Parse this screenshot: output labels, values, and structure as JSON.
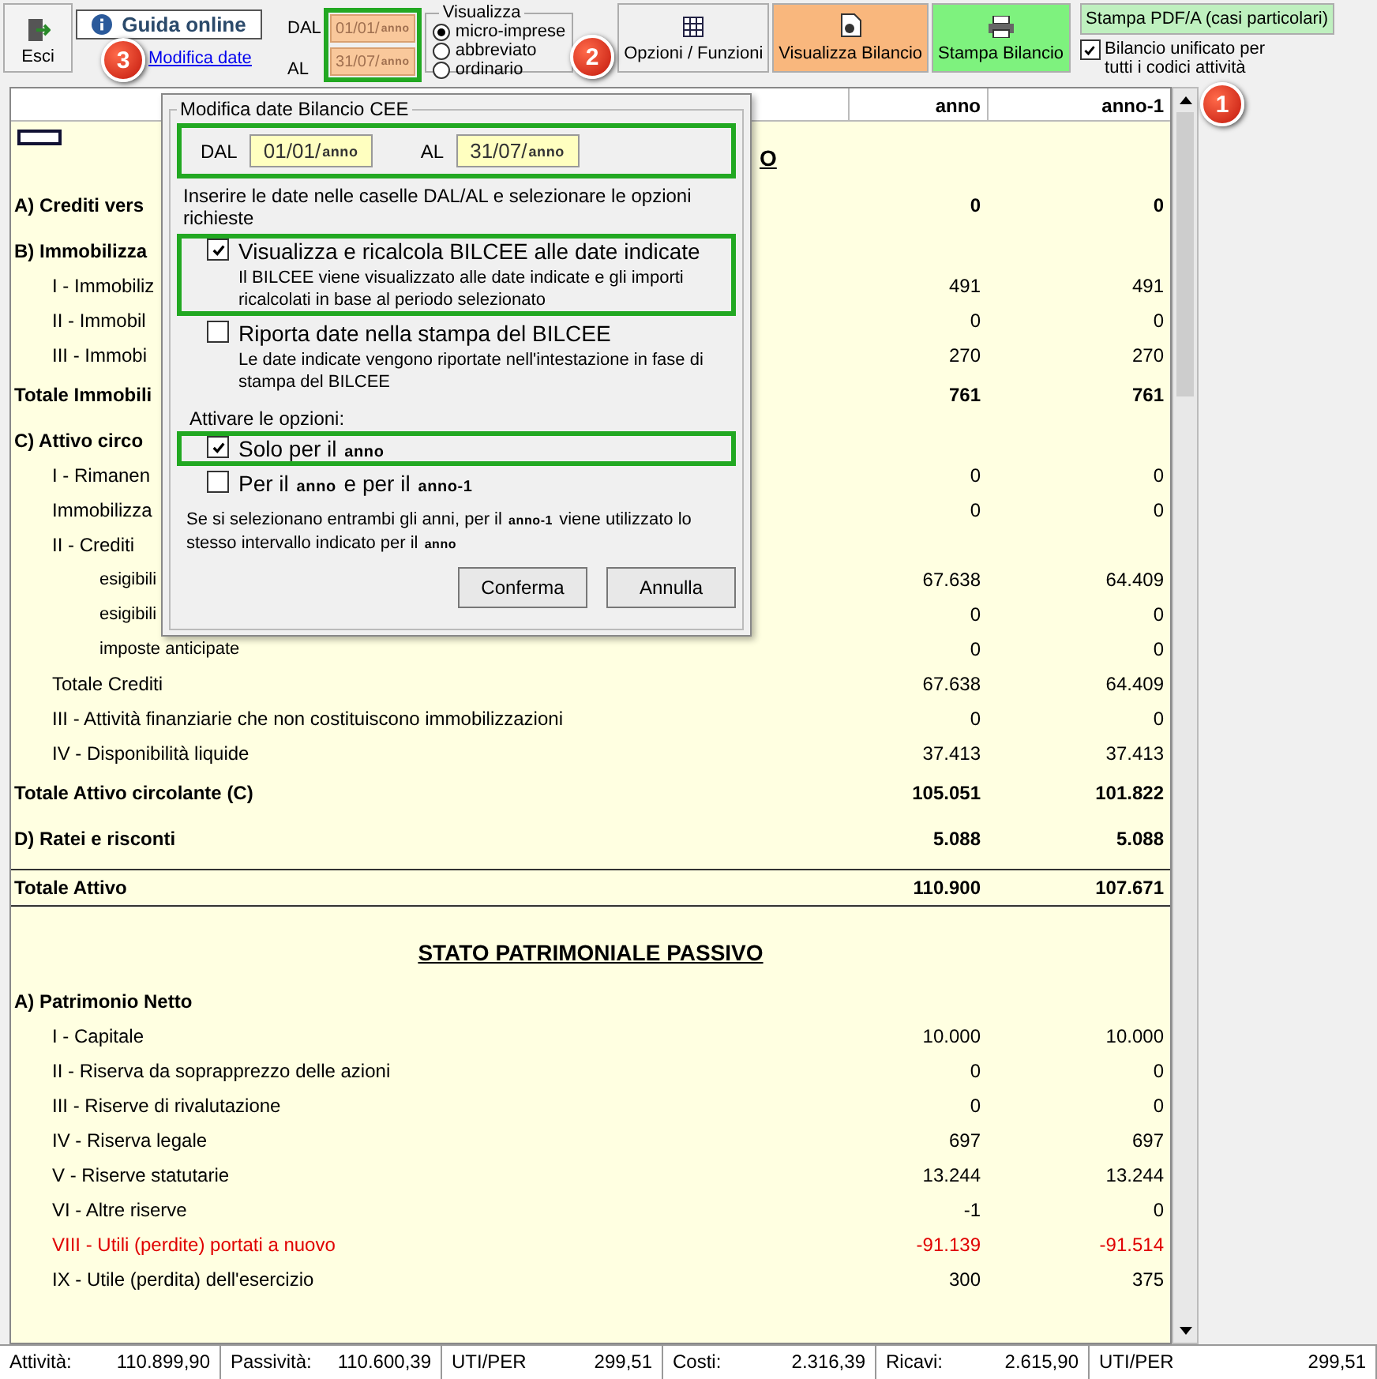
{
  "toolbar": {
    "exit": "Esci",
    "help": "Guida online",
    "edit_dates_link": "Modifica date",
    "dal_label": "DAL",
    "al_label": "AL",
    "dal": {
      "text": "01/01/",
      "token": "anno"
    },
    "al": {
      "text": "31/07/",
      "token": "anno"
    },
    "view": {
      "legend": "Visualizza",
      "options": [
        {
          "label": "micro-imprese",
          "selected": true
        },
        {
          "label": "abbreviato",
          "selected": false
        },
        {
          "label": "ordinario",
          "selected": false
        }
      ]
    },
    "buttons": [
      {
        "label": "Opzioni / Funzioni",
        "color": "#f0f0f0"
      },
      {
        "label": "Visualizza Bilancio",
        "color": "#f9b77d"
      },
      {
        "label": "Stampa Bilancio",
        "color": "#7ef27e"
      }
    ],
    "pdf_button": "Stampa PDF/A (casi particolari)",
    "unified": {
      "label": "Bilancio unificato per tutti i codici attività",
      "checked": true
    }
  },
  "callouts": [
    {
      "number": "1"
    },
    {
      "number": "2"
    },
    {
      "number": "3"
    }
  ],
  "table": {
    "columns": [
      "anno",
      "anno-1"
    ],
    "section_title": "O",
    "rows": [
      {
        "kind": "section",
        "label": "A) Crediti vers",
        "values": [
          "0",
          "0"
        ]
      },
      {
        "kind": "section",
        "label": "B) Immobilizza",
        "values": []
      },
      {
        "kind": "item",
        "label": "I - Immobiliz",
        "values": [
          "491",
          "491"
        ]
      },
      {
        "kind": "item",
        "label": "II - Immobil",
        "values": [
          "0",
          "0"
        ]
      },
      {
        "kind": "item",
        "label": "III - Immobi",
        "values": [
          "270",
          "270"
        ]
      },
      {
        "kind": "total",
        "label": "Totale Immobili",
        "values": [
          "761",
          "761"
        ]
      },
      {
        "kind": "section",
        "label": "C) Attivo circo",
        "values": []
      },
      {
        "kind": "item",
        "label": "I - Rimanen",
        "values": [
          "0",
          "0"
        ]
      },
      {
        "kind": "item",
        "label": "Immobilizza",
        "values": [
          "0",
          "0"
        ]
      },
      {
        "kind": "item",
        "label": "II - Crediti",
        "values": []
      },
      {
        "kind": "sub",
        "label": "esigibili",
        "values": [
          "67.638",
          "64.409"
        ]
      },
      {
        "kind": "sub",
        "label": "esigibili",
        "values": [
          "0",
          "0"
        ]
      },
      {
        "kind": "sub",
        "label": "imposte anticipate",
        "values": [
          "0",
          "0"
        ]
      },
      {
        "kind": "item",
        "label": "Totale Crediti",
        "values": [
          "67.638",
          "64.409"
        ]
      },
      {
        "kind": "item",
        "label": "III - Attività finanziarie che non costituiscono immobilizzazioni",
        "values": [
          "0",
          "0"
        ]
      },
      {
        "kind": "item",
        "label": "IV - Disponibilità liquide",
        "values": [
          "37.413",
          "37.413"
        ]
      },
      {
        "kind": "total",
        "label": "Totale Attivo circolante (C)",
        "values": [
          "105.051",
          "101.822"
        ]
      },
      {
        "kind": "section",
        "label": "D) Ratei e risconti",
        "values": [
          "5.088",
          "5.088"
        ]
      },
      {
        "kind": "grand",
        "label": "Totale Attivo",
        "values": [
          "110.900",
          "107.671"
        ]
      },
      {
        "kind": "heading",
        "label": "STATO PATRIMONIALE PASSIVO",
        "values": []
      },
      {
        "kind": "section",
        "label": "A) Patrimonio Netto",
        "values": []
      },
      {
        "kind": "item",
        "label": "I - Capitale",
        "values": [
          "10.000",
          "10.000"
        ]
      },
      {
        "kind": "item",
        "label": "II - Riserva da soprapprezzo delle azioni",
        "values": [
          "0",
          "0"
        ]
      },
      {
        "kind": "item",
        "label": "III - Riserve di rivalutazione",
        "values": [
          "0",
          "0"
        ]
      },
      {
        "kind": "item",
        "label": "IV - Riserva legale",
        "values": [
          "697",
          "697"
        ]
      },
      {
        "kind": "item",
        "label": "V - Riserve statutarie",
        "values": [
          "13.244",
          "13.244"
        ]
      },
      {
        "kind": "item",
        "label": "VI - Altre riserve",
        "values": [
          "-1",
          "0"
        ]
      },
      {
        "kind": "negative",
        "label": "VIII - Utili (perdite) portati a nuovo",
        "values": [
          "-91.139",
          "-91.514"
        ]
      },
      {
        "kind": "item",
        "label": "IX - Utile (perdita) dell'esercizio",
        "values": [
          "300",
          "375"
        ]
      }
    ]
  },
  "dialog": {
    "title": "Modifica date Bilancio CEE",
    "dal_label": "DAL",
    "al_label": "AL",
    "dal": {
      "text": "01/01/",
      "token": "anno"
    },
    "al": {
      "text": "31/07/",
      "token": "anno"
    },
    "instructions": "Inserire le date nelle caselle DAL/AL e selezionare le opzioni richieste",
    "options": [
      {
        "label": "Visualizza e ricalcola BILCEE alle date indicate",
        "description": "Il BILCEE viene visualizzato alle date indicate e gli importi ricalcolati in base al periodo selezionato",
        "checked": true,
        "highlighted": true
      },
      {
        "label": "Riporta date nella stampa del BILCEE",
        "description": "Le date indicate vengono riportate nell'intestazione in fase di stampa del BILCEE",
        "checked": false,
        "highlighted": false
      }
    ],
    "activate_label": "Attivare le opzioni:",
    "years": [
      {
        "parts": [
          {
            "kind": "word",
            "text": "Solo per il"
          },
          {
            "kind": "token",
            "text": "anno"
          }
        ],
        "checked": true,
        "highlighted": true
      },
      {
        "parts": [
          {
            "kind": "word",
            "text": "Per il"
          },
          {
            "kind": "token",
            "text": "anno"
          },
          {
            "kind": "word",
            "text": "e per il"
          },
          {
            "kind": "token",
            "text": "anno-1"
          }
        ],
        "checked": false,
        "highlighted": false
      }
    ],
    "note": [
      {
        "kind": "word",
        "text": "Se si selezionano entrambi gli anni, per il"
      },
      {
        "kind": "token",
        "text": "anno-1"
      },
      {
        "kind": "word",
        "text": "viene utilizzato lo stesso intervallo indicato per il"
      },
      {
        "kind": "token",
        "text": "anno"
      }
    ],
    "buttons": [
      "Conferma",
      "Annulla"
    ]
  },
  "status_bar": [
    {
      "label": "Attività:",
      "value": "110.899,90"
    },
    {
      "label": "Passività:",
      "value": "110.600,39"
    },
    {
      "label": "UTI/PER",
      "value": "299,51"
    },
    {
      "label": "Costi:",
      "value": "2.316,39"
    },
    {
      "label": "Ricavi:",
      "value": "2.615,90"
    },
    {
      "label": "UTI/PER",
      "value": "299,51"
    }
  ]
}
